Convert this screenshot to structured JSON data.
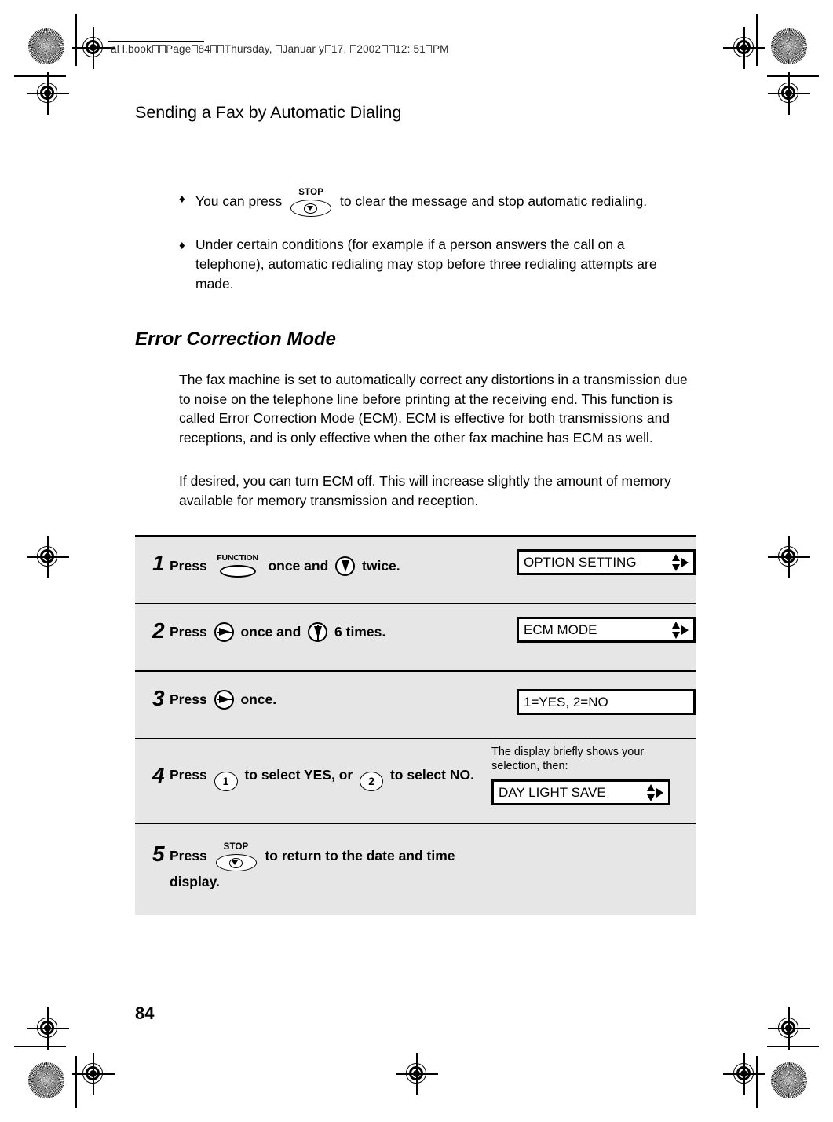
{
  "header": {
    "file_info_parts": [
      "al l.book",
      "Page",
      "84",
      "Thursday, ",
      "J",
      "anuar y",
      "17, ",
      "2002",
      "12: 51",
      "PM"
    ],
    "file_info_text": "al l.book  Page 84  Thursday,  January 17,  2002  12: 51 PM"
  },
  "running_head": "Sending a Fax by Automatic Dialing",
  "notes": [
    {
      "bullet": "♦",
      "text_before": "You can press",
      "key": "STOP",
      "text_after": "to clear the message and stop automatic redialing."
    },
    {
      "bullet": "♦",
      "text": "Under certain conditions (for example if a person answers the call on a telephone), automatic redialing may stop before three redialing attempts are made."
    }
  ],
  "section": {
    "heading": "Error Correction Mode",
    "paragraphs": [
      "The fax machine is set to automatically correct any distortions in a transmission due to noise on the telephone line before printing at the receiving end. This function is called Error Correction Mode (ECM). ECM is effective for both transmissions and receptions, and is only effective when the other fax machine has ECM as well.",
      "If desired, you can turn ECM off. This will increase slightly the amount of memory available for memory transmission and reception."
    ]
  },
  "procedure": {
    "steps": [
      {
        "number": "1",
        "text_1": "Press",
        "key_1_label": "FUNCTION",
        "text_2": "once and",
        "key_2": "down-arrow-key",
        "text_3": "twice.",
        "display": "OPTION SETTING",
        "display_arrows": "updown-right"
      },
      {
        "number": "2",
        "text_1": "Press",
        "key_1": "right-arrow-key",
        "text_2": "once and",
        "key_2": "down-arrow-key",
        "text_3": "6 times.",
        "display": "ECM MODE",
        "display_arrows": "updown-right"
      },
      {
        "number": "3",
        "text_1": "Press",
        "key_1": "right-arrow-key",
        "text_2": "once.",
        "display": "1=YES, 2=NO",
        "display_arrows": "none"
      },
      {
        "number": "4",
        "text_1": "Press",
        "key_1_label": "1",
        "text_2": "to select YES, or",
        "key_2_label": "2",
        "text_3": "to select NO.",
        "side_note": "The display briefly shows your selection, then:",
        "display": "DAY LIGHT SAVE",
        "display_arrows": "updown-right"
      },
      {
        "number": "5",
        "text_1": "Press",
        "key_1_label": "STOP",
        "text_2": "to return to the date and time display.",
        "display": null,
        "display_arrows": "none"
      }
    ]
  },
  "page_number": "84",
  "colors": {
    "table_background": "#e6e6e6",
    "ink": "#000000",
    "paper": "#ffffff"
  }
}
